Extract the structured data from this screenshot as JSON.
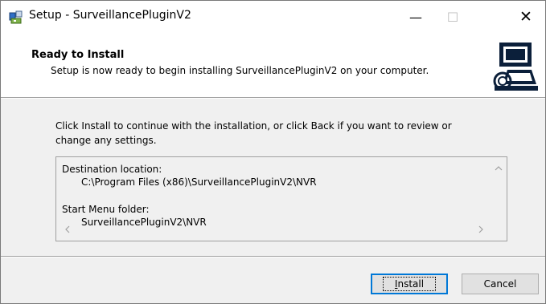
{
  "window": {
    "title": "Setup - SurveillancePluginV2",
    "controls": {
      "minimize": "—",
      "maximize": "☐",
      "close": "✕"
    }
  },
  "header": {
    "title": "Ready to Install",
    "description": "Setup is now ready to begin installing SurveillancePluginV2 on your computer.",
    "image": "setup-computer-icon"
  },
  "main": {
    "instruction_line1": "Click Install to continue with the installation, or click Back if you want to review or",
    "instruction_line2": "change any settings.",
    "memo": {
      "destination_label": "Destination location:",
      "destination_value": "C:\\Program Files (x86)\\SurveillancePluginV2\\NVR",
      "start_menu_label": "Start Menu folder:",
      "start_menu_value": "SurveillancePluginV2\\NVR"
    }
  },
  "buttons": {
    "install_first": "I",
    "install_rest": "nstall",
    "cancel": "Cancel"
  },
  "colors": {
    "focus_border": "#0078d7",
    "panel": "#f0f0f0",
    "header_bg": "#ffffff"
  }
}
